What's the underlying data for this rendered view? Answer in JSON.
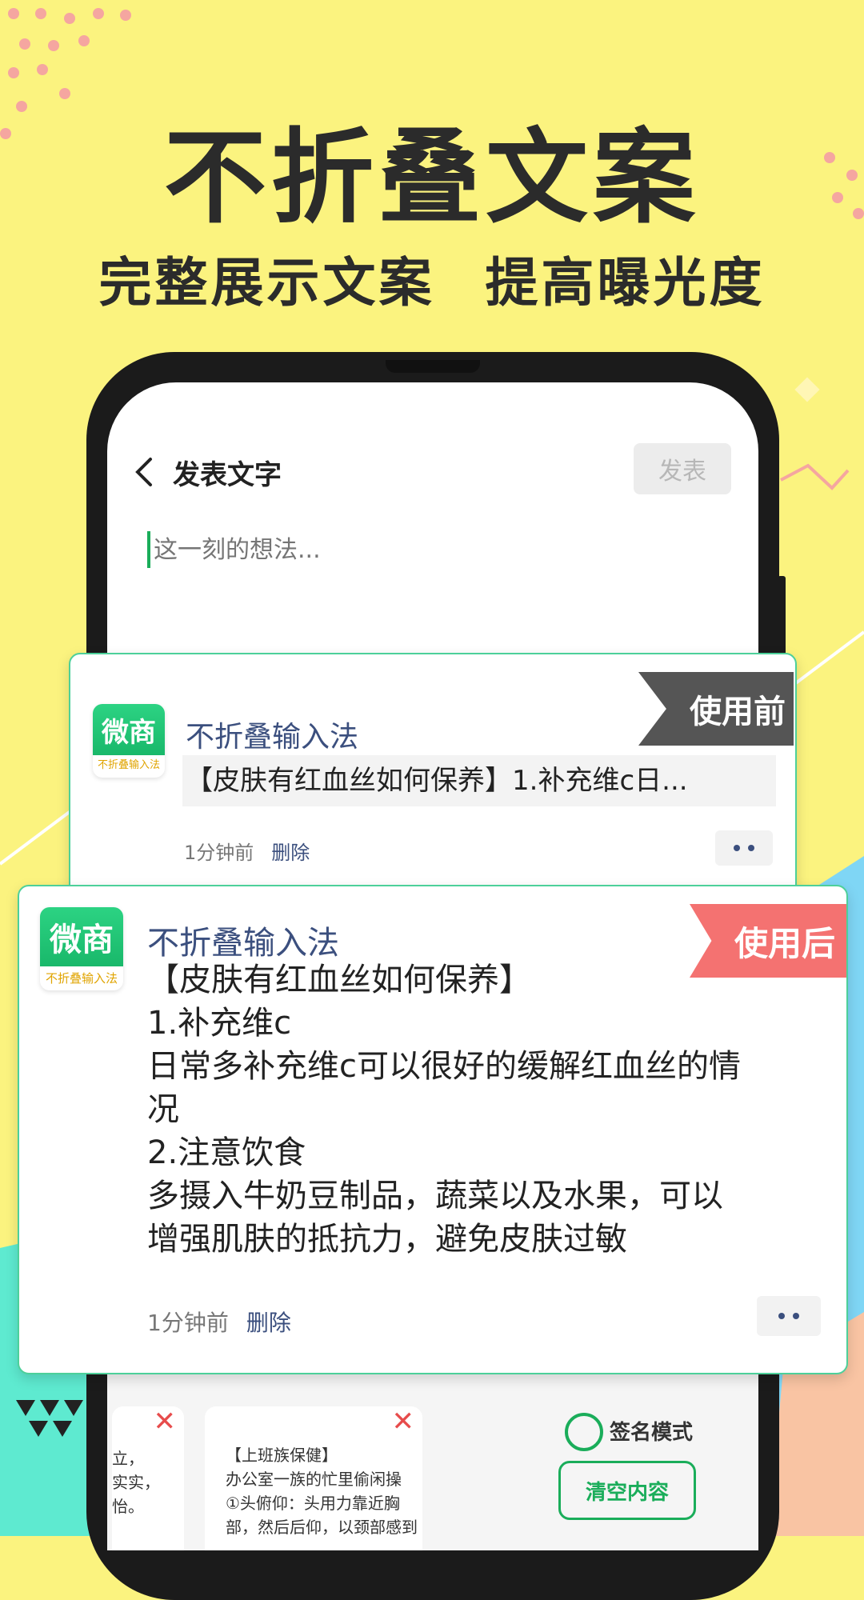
{
  "hero": {
    "title": "不折叠文案",
    "subtitle_left": "完整展示文案",
    "subtitle_right": "提高曝光度"
  },
  "screen": {
    "title": "发表文字",
    "publish_label": "发表",
    "placeholder": "这一刻的想法...",
    "signature_label": "签名模式",
    "clear_label": "清空内容",
    "thumb_left_lines": [
      "立，",
      "实实，",
      "怡。"
    ],
    "thumb_mid_lines": [
      "【上班族保健】",
      "办公室一族的忙里偷闲操",
      "①头俯仰：头用力靠近胸",
      "部，然后后仰，以颈部感到"
    ],
    "close_glyph": "✕"
  },
  "app_logo": {
    "top": "微商",
    "bottom": "不折叠输入法"
  },
  "card_before": {
    "tag": "使用前",
    "app_name": "不折叠输入法",
    "preview": "【皮肤有红血丝如何保养】1.补充维c日...",
    "time": "1分钟前",
    "delete": "删除"
  },
  "card_after": {
    "tag": "使用后",
    "app_name": "不折叠输入法",
    "lines": [
      "【皮肤有红血丝如何保养】",
      "1.补充维c",
      "日常多补充维c可以很好的缓解红血丝的情",
      "况",
      "2.注意饮食",
      "多摄入牛奶豆制品，蔬菜以及水果，可以",
      "增强肌肤的抵抗力，避免皮肤过敏"
    ],
    "time": "1分钟前",
    "delete": "删除"
  },
  "colors": {
    "background": "#fbf37f",
    "accent_green": "#1aad5a",
    "tag_before": "#555555",
    "tag_after": "#f47271",
    "name_blue": "#3b4f7e"
  }
}
